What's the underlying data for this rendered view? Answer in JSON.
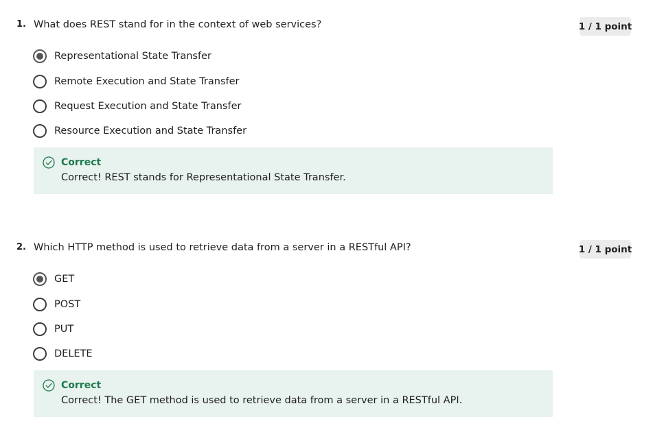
{
  "questions": [
    {
      "number": "1.",
      "text": "What does REST stand for in the context of web services?",
      "points": "1 / 1 point",
      "selected_index": 0,
      "options": [
        {
          "label": "Representational State Transfer",
          "selected": true
        },
        {
          "label": "Remote Execution and State Transfer",
          "selected": false
        },
        {
          "label": "Request Execution and State Transfer",
          "selected": false
        },
        {
          "label": "Resource Execution and State Transfer",
          "selected": false
        }
      ],
      "feedback": {
        "status": "Correct",
        "message": "Correct! REST stands for Representational State Transfer.",
        "icon": "check-circle-icon",
        "status_color": "#1b7a4a",
        "background_color": "#e8f2ee"
      }
    },
    {
      "number": "2.",
      "text": "Which HTTP method is used to retrieve data from a server in a RESTful API?",
      "points": "1 / 1 point",
      "selected_index": 0,
      "options": [
        {
          "label": "GET",
          "selected": true
        },
        {
          "label": "POST",
          "selected": false
        },
        {
          "label": "PUT",
          "selected": false
        },
        {
          "label": "DELETE",
          "selected": false
        }
      ],
      "feedback": {
        "status": "Correct",
        "message": "Correct! The GET method is used to retrieve data from a server in a RESTful API.",
        "icon": "check-circle-icon",
        "status_color": "#1b7a4a",
        "background_color": "#e8f2ee"
      }
    }
  ]
}
